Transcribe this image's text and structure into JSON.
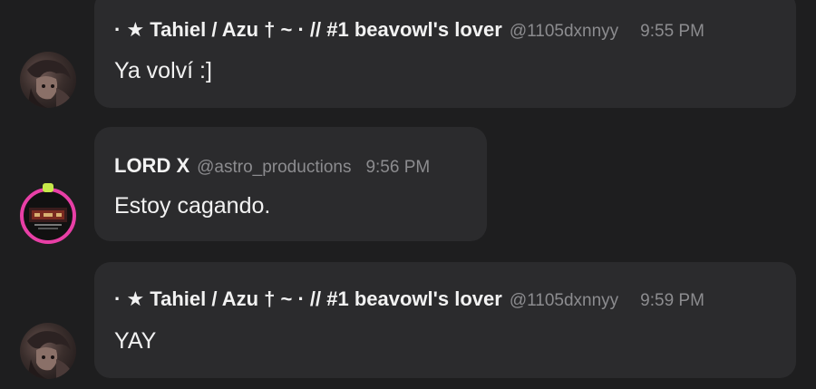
{
  "messages": [
    {
      "author": "· ★ Tahiel / Azu † ~ · // #1 beavowl's lover",
      "handle": "@1105dxnnyy",
      "time": "9:55 PM",
      "text": "Ya volví :]",
      "avatar": "tahiel-avatar"
    },
    {
      "author": "LORD X",
      "handle": "@astro_productions",
      "time": "9:56 PM",
      "text": "Estoy cagando.",
      "avatar": "lord-x-avatar"
    },
    {
      "author": "· ★ Tahiel / Azu † ~ · // #1 beavowl's lover",
      "handle": "@1105dxnnyy",
      "time": "9:59 PM",
      "text": "YAY",
      "avatar": "tahiel-avatar"
    }
  ],
  "colors": {
    "background": "#1e1e1f",
    "bubble": "#2b2b2d",
    "text": "#f2f2f2",
    "muted": "#8c8c8f",
    "avatar_ring": "#e83fa6"
  }
}
